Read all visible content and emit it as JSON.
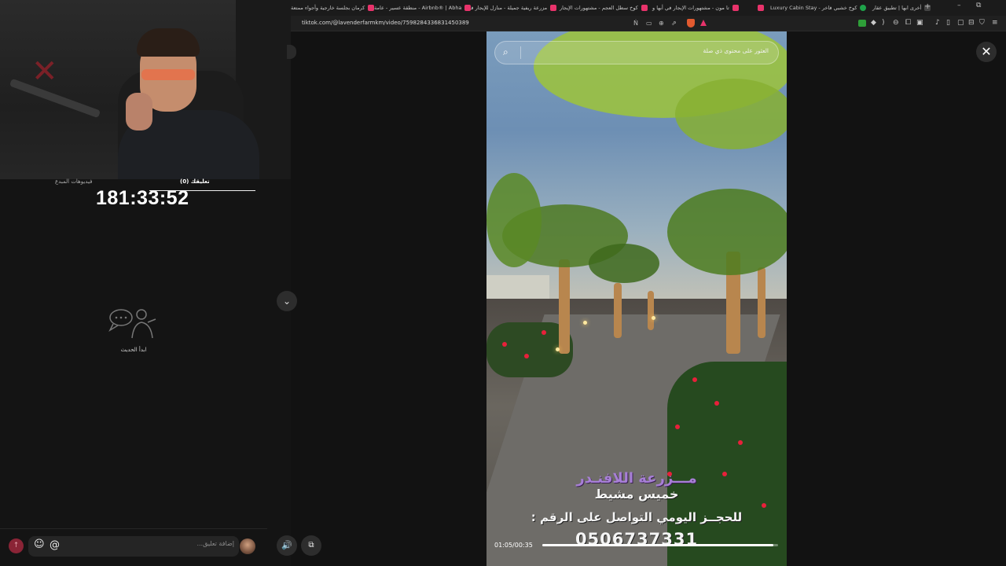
{
  "browser": {
    "tabs": [
      {
        "label": "أخرى ابها | تطبيق عقار",
        "icon": "favicon"
      },
      {
        "label": "كوخ خشبي فاخر - Luxury Cabin Stay",
        "icon": "favicon-green"
      },
      {
        "label": "تا مون - مشتهورات الإيجار في أبها و",
        "icon": "favicon-airbnb"
      },
      {
        "label": "كوخ سطل العجم - مشتهورات الإيجار",
        "icon": "favicon-airbnb"
      },
      {
        "label": "مزرعة ريفية جميلة - منازل للإيجار في",
        "icon": "favicon-airbnb"
      },
      {
        "label": "Airbnb® | Abha - منطقة عسير - عامة",
        "icon": "favicon-airbnb"
      },
      {
        "label": "كرمان بجلسة خارجية وأجواء ممتعة",
        "icon": "favicon-airbnb"
      }
    ],
    "new_tab_label": "+",
    "minimize_label": "–",
    "restore_label": "⧉",
    "url": "tiktok.com/@lavenderfarmkm/video/7598284336831450389"
  },
  "stream_overlay": {
    "tab_comments": "(0) تعليقك",
    "tab_videos": "فيديوهات المبدع",
    "timer": "181:33:52",
    "empty_text": "ابدأ الحديث",
    "comment_placeholder": "إضافة تعليق...",
    "send_icon": "send-icon",
    "at_symbol": "@",
    "emoji_symbol": "☺"
  },
  "search": {
    "placeholder": "العثور على محتوى ذي صلة"
  },
  "video": {
    "captions": [
      "مـــزرعة اللافنـدر",
      "خميس مشيط",
      "للحجــز اليومي التواصل على الرقم :",
      "0506737331"
    ],
    "time_readout": "01:05/00:35",
    "progress": 0.98
  },
  "controls": {
    "close_label": "✕",
    "scroll_down_label": "⌄",
    "volume_label": "🔊",
    "miniplayer_label": "⧉"
  }
}
